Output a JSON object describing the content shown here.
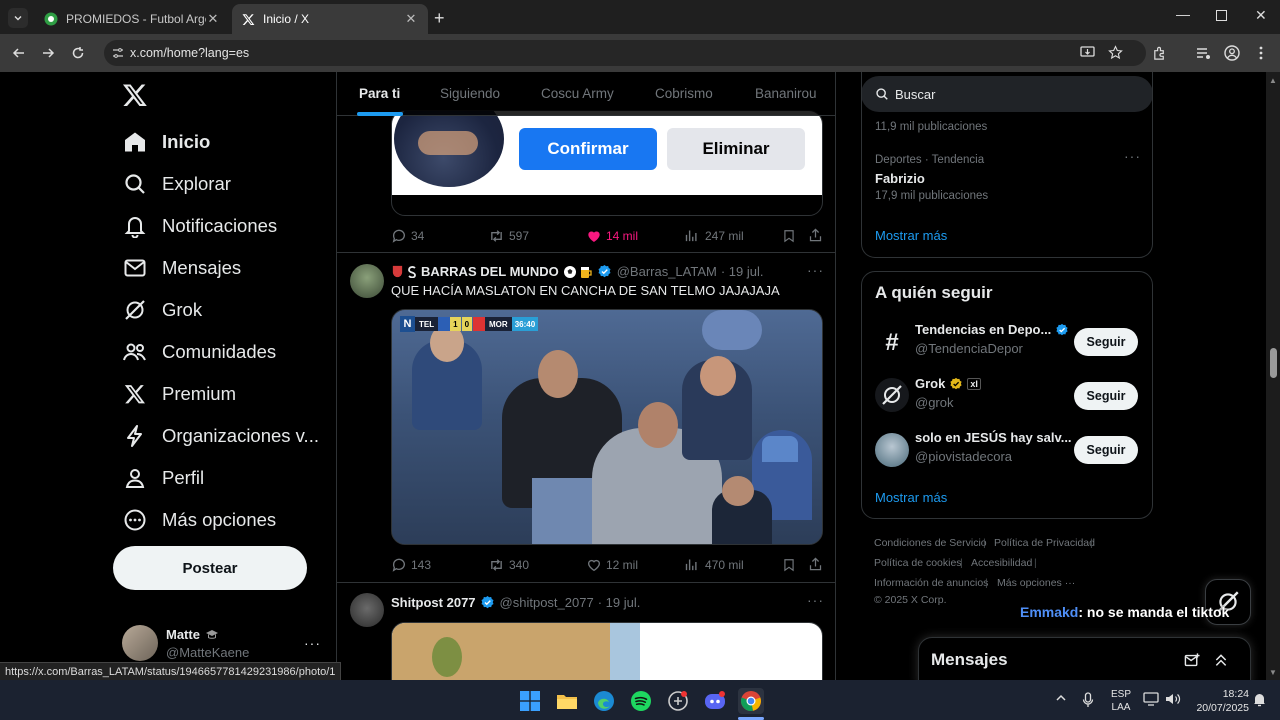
{
  "browser": {
    "tabs": [
      {
        "label": "PROMIEDOS - Futbol Argentino",
        "active": false
      },
      {
        "label": "Inicio / X",
        "active": true
      }
    ],
    "url": "x.com/home?lang=es",
    "status_url": "https://x.com/Barras_LATAM/status/1946657781429231986/photo/1"
  },
  "nav": {
    "items": [
      {
        "label": "Inicio",
        "icon": "home-icon"
      },
      {
        "label": "Explorar",
        "icon": "search-icon"
      },
      {
        "label": "Notificaciones",
        "icon": "bell-icon"
      },
      {
        "label": "Mensajes",
        "icon": "mail-icon"
      },
      {
        "label": "Grok",
        "icon": "grok-icon"
      },
      {
        "label": "Comunidades",
        "icon": "people-icon"
      },
      {
        "label": "Premium",
        "icon": "x-logo-icon"
      },
      {
        "label": "Organizaciones v...",
        "icon": "lightning-icon"
      },
      {
        "label": "Perfil",
        "icon": "person-icon"
      },
      {
        "label": "Más opciones",
        "icon": "more-circle-icon"
      }
    ],
    "post_label": "Postear",
    "account": {
      "name": "Matte",
      "handle": "@MatteKaene"
    }
  },
  "feed": {
    "tabs": [
      "Para ti",
      "Siguiendo",
      "Coscu Army",
      "Cobrismo",
      "Bananirou"
    ],
    "prev_post": {
      "confirm_label": "Confirmar",
      "delete_label": "Eliminar",
      "replies": "34",
      "reposts": "597",
      "likes": "14 mil",
      "views": "247 mil"
    },
    "post1": {
      "name": "BARRAS DEL MUNDO",
      "handle": "@Barras_LATAM",
      "date": "· 19 jul.",
      "text": "QUE HACÍA MASLATON EN CANCHA DE SAN TELMO JAJAJAJA",
      "scoreboard": {
        "team1": "TEL",
        "score1": "1",
        "score2": "0",
        "team2": "MOR",
        "clock": "36:40"
      },
      "replies": "143",
      "reposts": "340",
      "likes": "12 mil",
      "views": "470 mil"
    },
    "post2": {
      "name": "Shitpost 2077",
      "handle": "@shitpost_2077",
      "date": "· 19 jul."
    }
  },
  "right": {
    "search_placeholder": "Buscar",
    "trends": {
      "top_count": "11,9 mil publicaciones",
      "item": {
        "context": "Deportes · Tendencia",
        "name": "Fabrizio",
        "count": "17,9 mil publicaciones"
      },
      "show_more": "Mostrar más"
    },
    "follow": {
      "title": "A quién seguir",
      "accounts": [
        {
          "name": "Tendencias en Depo...",
          "handle": "@TendenciaDepor"
        },
        {
          "name": "Grok",
          "handle": "@grok",
          "badge": "xI"
        },
        {
          "name": "solo en JESÚS hay salv...",
          "handle": "@piovistadecora"
        }
      ],
      "button_label": "Seguir",
      "show_more": "Mostrar más"
    },
    "footer": {
      "links": [
        "Condiciones de Servicio",
        "Política de Privacidad",
        "Política de cookies",
        "Accesibilidad",
        "Información de anuncios",
        "Más opciones ···"
      ],
      "copyright": "© 2025 X Corp."
    },
    "chat_overlay": {
      "user": "Emmakd",
      "message": ": no se manda el tiktok"
    },
    "messages_title": "Mensajes"
  },
  "taskbar": {
    "lang": "ESP",
    "lang2": "LAA",
    "time": "18:24",
    "date": "20/07/2025"
  },
  "colors": {
    "accent": "#1d9bf0",
    "like": "#f91880",
    "background": "#000000"
  }
}
